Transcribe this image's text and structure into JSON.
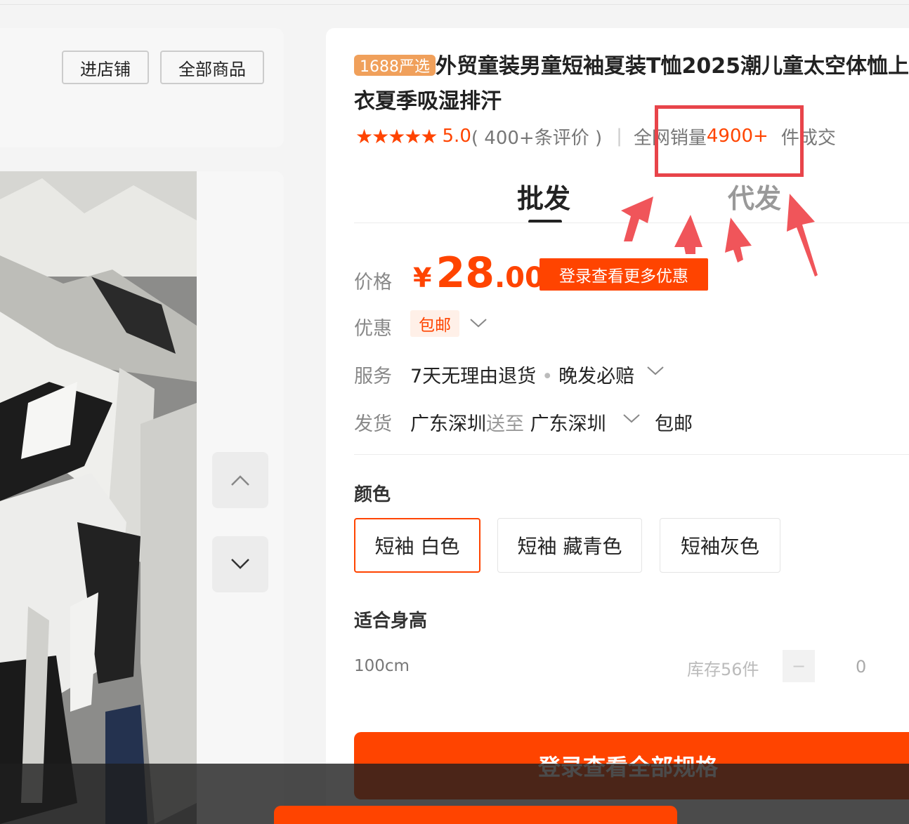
{
  "shop": {
    "enter_store": "进店铺",
    "all_products": "全部商品"
  },
  "gallery": {
    "up_icon": "chevron-up-icon",
    "down_icon": "chevron-down-icon"
  },
  "product": {
    "badge": "1688严选",
    "title": "外贸童装男童短袖夏装T恤2025潮儿童太空体恤上衣夏季吸湿排汗",
    "rating": {
      "stars": "★★★★★",
      "score": "5.0",
      "reviews": "( 400+条评价 )",
      "separator": "|",
      "sales_prefix": "全网销量",
      "sales_value": "4900+",
      "sales_suffix": "件成交"
    },
    "tabs": [
      {
        "label": "批发",
        "active": true
      },
      {
        "label": "代发",
        "active": false
      }
    ],
    "price": {
      "label": "价格",
      "currency": "¥",
      "integer": "28",
      "decimal": ".00",
      "promo_button": "登录查看更多优惠"
    },
    "discount": {
      "label": "优惠",
      "tag": "包邮"
    },
    "service": {
      "label": "服务",
      "item1": "7天无理由退货",
      "dot": "•",
      "item2": "晚发必赔"
    },
    "shipping": {
      "label": "发货",
      "from": "广东深圳",
      "to_label": "送至",
      "to": "广东深圳",
      "fee": "包邮"
    },
    "color": {
      "title": "颜色",
      "options": [
        "短袖 白色",
        "短袖 藏青色",
        "短袖灰色"
      ],
      "selected_index": 0
    },
    "height": {
      "title": "适合身高",
      "rows": [
        {
          "name": "100cm",
          "stock": "库存56件",
          "minus": "−",
          "qty": "0"
        }
      ]
    },
    "cta": "登录查看全部规格"
  },
  "colors": {
    "accent": "#ff4400",
    "annotation": "#e8444a",
    "badge": "#f0a05b"
  }
}
